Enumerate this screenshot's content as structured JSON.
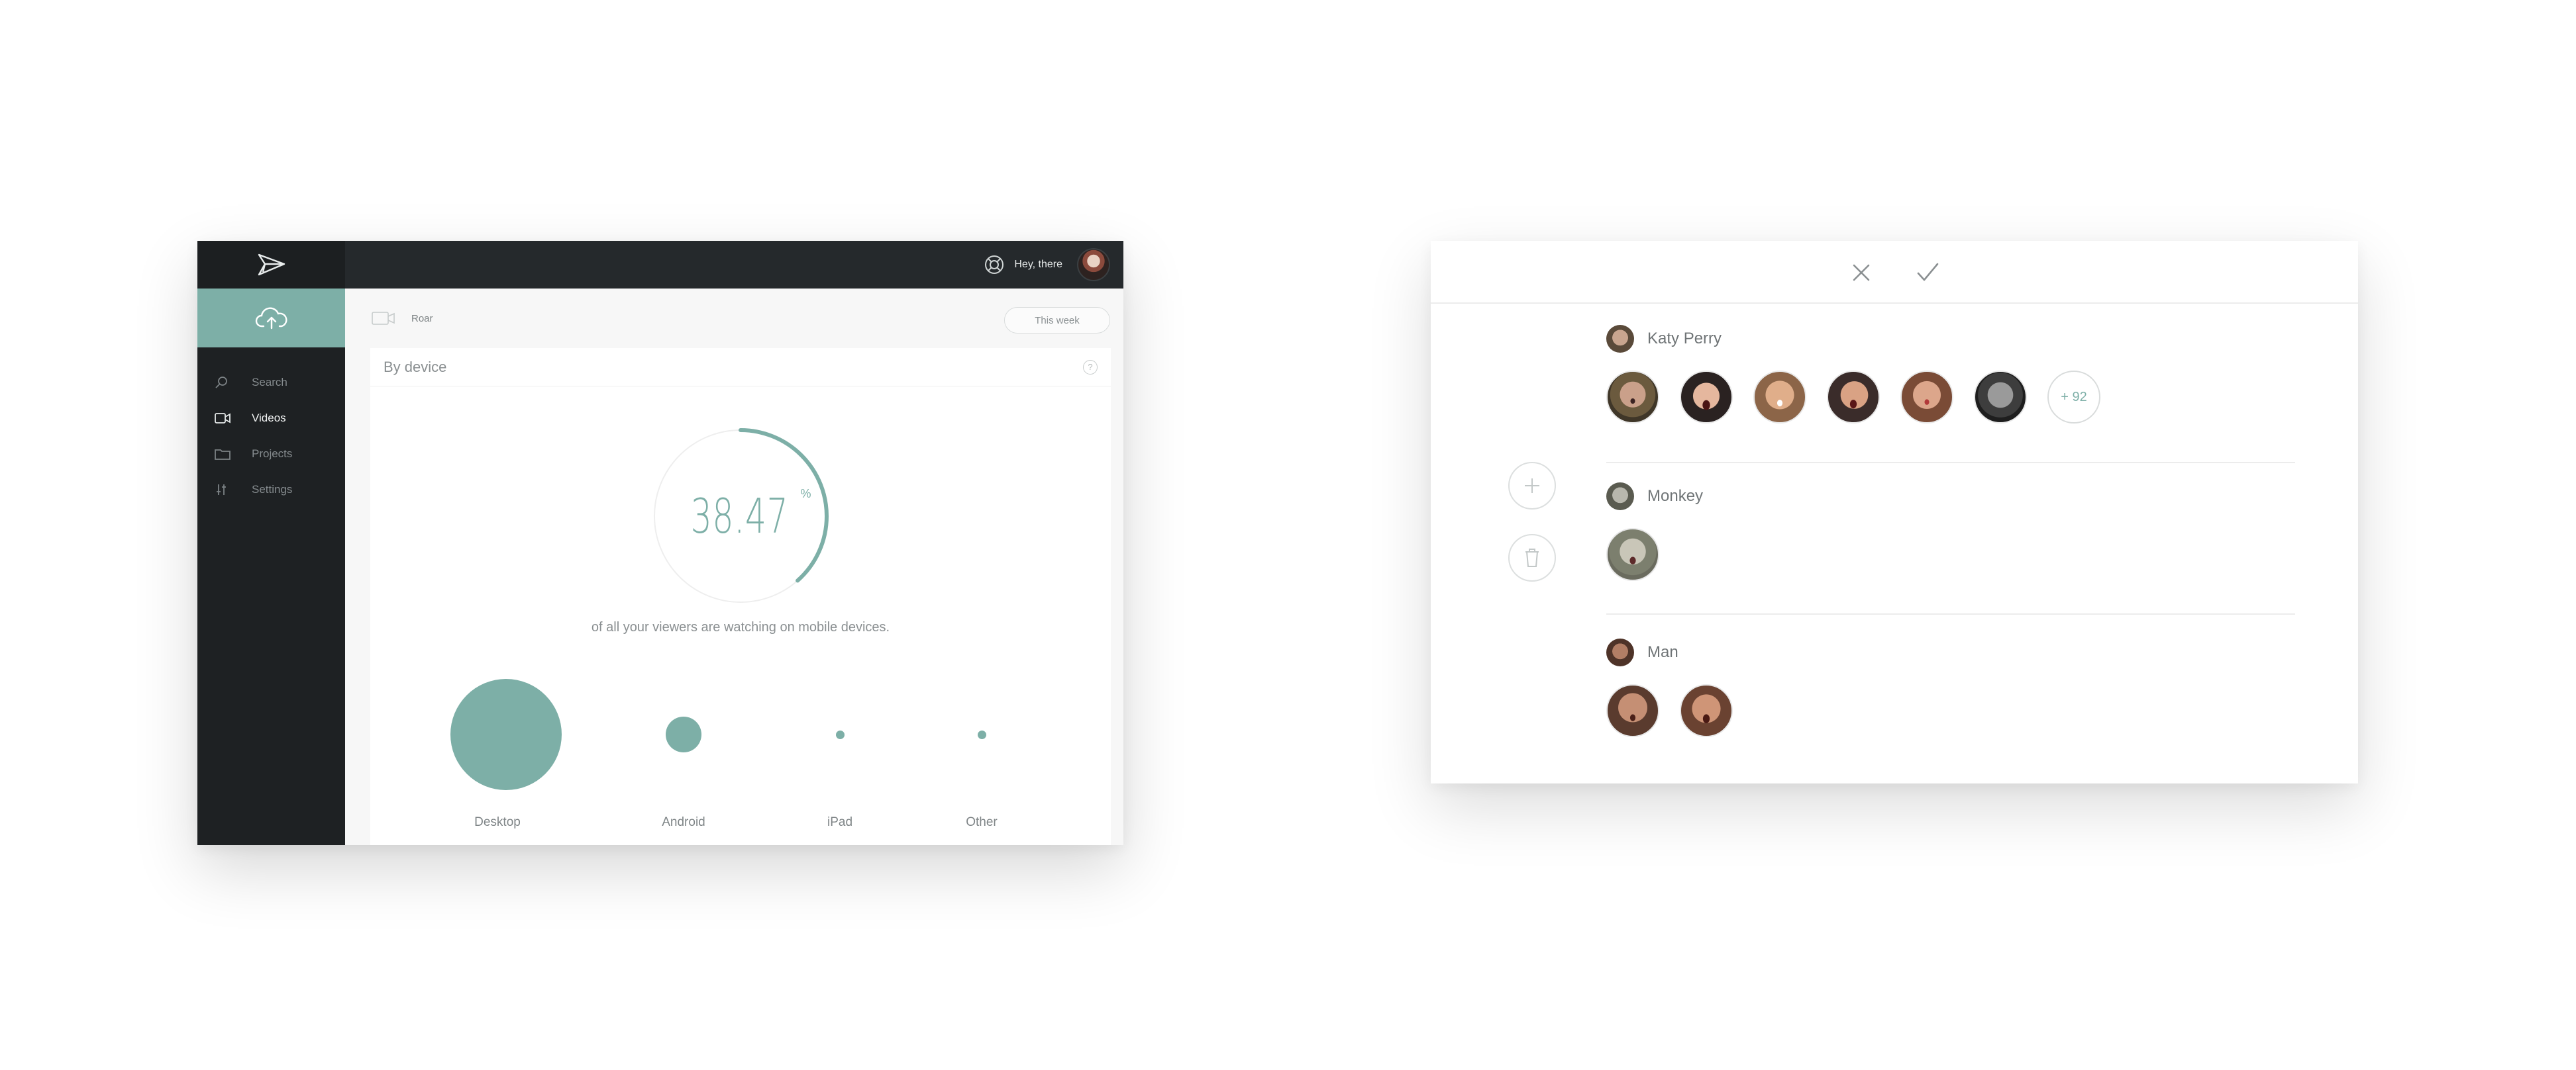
{
  "dashboard": {
    "header": {
      "greeting": "Hey, there"
    },
    "sidebar": {
      "items": [
        {
          "label": "Search",
          "icon": "search-icon",
          "active": false
        },
        {
          "label": "Videos",
          "icon": "video-icon",
          "active": true
        },
        {
          "label": "Projects",
          "icon": "folder-icon",
          "active": false
        },
        {
          "label": "Settings",
          "icon": "sliders-icon",
          "active": false
        }
      ]
    },
    "toolbar": {
      "video_name": "Roar",
      "period_button": "This week"
    },
    "card": {
      "title": "By device",
      "gauge_value": "38.47",
      "gauge_unit": "%",
      "gauge_fraction": 0.3847,
      "caption": "of all your viewers are watching on mobile devices."
    },
    "devices": [
      {
        "label": "Desktop"
      },
      {
        "label": "Android"
      },
      {
        "label": "iPad"
      },
      {
        "label": "Other"
      }
    ],
    "colors": {
      "accent": "#7dafa7",
      "topbar": "#25292c",
      "sidebar": "#1e2123"
    }
  },
  "face_panel": {
    "actions": {
      "cancel": "close-icon",
      "confirm": "check-icon"
    },
    "side_actions": {
      "add": "plus-icon",
      "delete": "trash-icon"
    },
    "groups": [
      {
        "name": "Katy Perry",
        "face_count": 6,
        "more": "+ 92"
      },
      {
        "name": "Monkey",
        "face_count": 1
      },
      {
        "name": "Man",
        "face_count": 2
      }
    ]
  }
}
